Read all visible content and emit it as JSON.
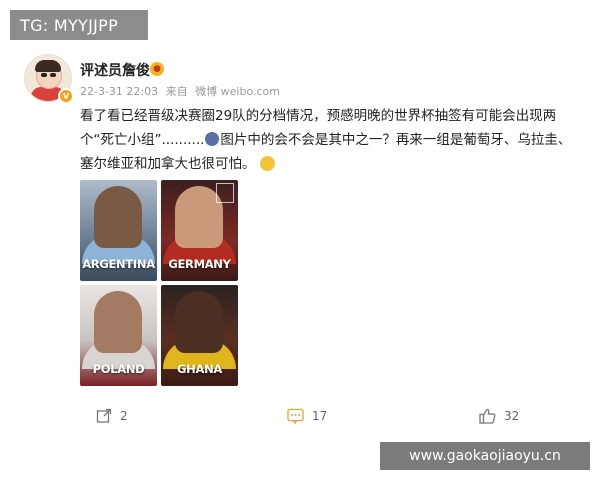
{
  "watermark_top": "TG: MYYJJPP",
  "watermark_bottom": "www.gaokaojiaoyu.cn",
  "user": {
    "name": "评述员詹俊"
  },
  "meta": {
    "timestamp": "22-3-31 22:03",
    "source_prefix": "来自",
    "source": "微博 weibo.com"
  },
  "post": {
    "text_part1": "看了看已经晋级决赛圈29队的分档情况，预感明晚的世界杯抽签有可能会出现两个“死亡小组”..........",
    "text_part2": "图片中的会不会是其中之一？再来一组是葡萄牙、乌拉圭、塞尔维亚和加拿大也很可怕。"
  },
  "images": [
    {
      "country": "ARGENTINA"
    },
    {
      "country": "GERMANY"
    },
    {
      "country": "POLAND"
    },
    {
      "country": "GHANA"
    }
  ],
  "actions": {
    "repost_count": "2",
    "comment_count": "17",
    "like_count": "32"
  },
  "icons": {
    "repost": "share-icon",
    "comment": "comment-icon",
    "like": "thumbs-up-icon",
    "verified": "verified-badge-icon"
  },
  "colors": {
    "accent": "#f7a11b",
    "comment": "#f0b34a",
    "text": "#222222",
    "meta": "#999999"
  }
}
